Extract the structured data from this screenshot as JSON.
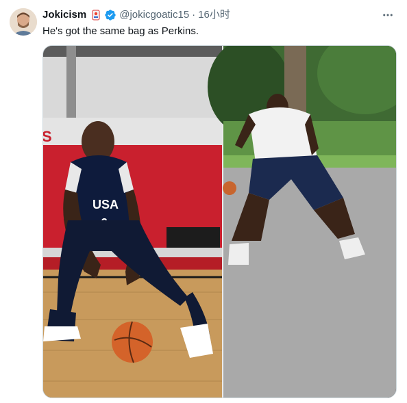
{
  "tweet": {
    "display_name": "Jokicism",
    "handle": "@jokicgoatic15",
    "separator": "·",
    "time": "16小时",
    "text": "He's got the same bag as Perkins."
  },
  "media": {
    "left_jersey_text": "USA",
    "left_jersey_number": "6",
    "wall_text": "S"
  },
  "colors": {
    "verified_blue": "#1d9bf0",
    "secondary_text": "#536471"
  },
  "icons": {
    "more": "more-horizontal-icon",
    "verified": "verified-badge-icon",
    "badge": "emoji-badge-icon"
  }
}
